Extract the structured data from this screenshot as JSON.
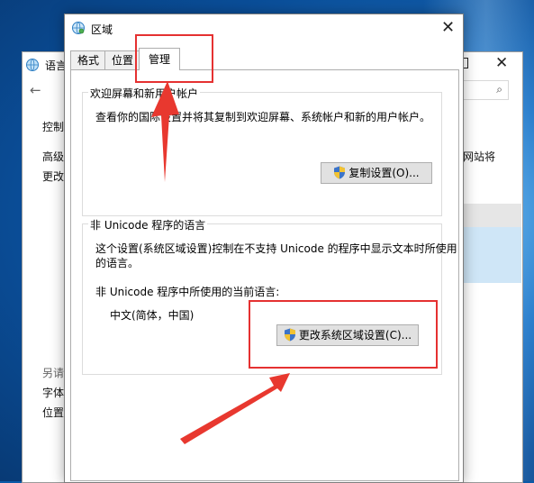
{
  "bg_window": {
    "title": "语言",
    "left_items": [
      "控制",
      "高级",
      "更改",
      "另请",
      "字体",
      "位置"
    ],
    "right_text": "网站将"
  },
  "dialog": {
    "title": "区域",
    "tabs": [
      {
        "label": "格式"
      },
      {
        "label": "位置"
      },
      {
        "label": "管理"
      }
    ],
    "welcome_group": {
      "legend": "欢迎屏幕和新用户帐户",
      "description": "查看你的国际设置并将其复制到欢迎屏幕、系统帐户和新的用户帐户。",
      "copy_button": "复制设置(O)..."
    },
    "unicode_group": {
      "legend": "非 Unicode 程序的语言",
      "description_line1": "这个设置(系统区域设置)控制在不支持 Unicode 的程序中显示文本时所使用",
      "description_line2": "的语言。",
      "current_label": "非 Unicode 程序中所使用的当前语言:",
      "current_value": "中文(简体，中国)",
      "change_button": "更改系统区域设置(C)..."
    }
  },
  "colors": {
    "annotation": "#e53131",
    "button_face": "#e1e1e1",
    "desktop": "#1f76c8"
  }
}
